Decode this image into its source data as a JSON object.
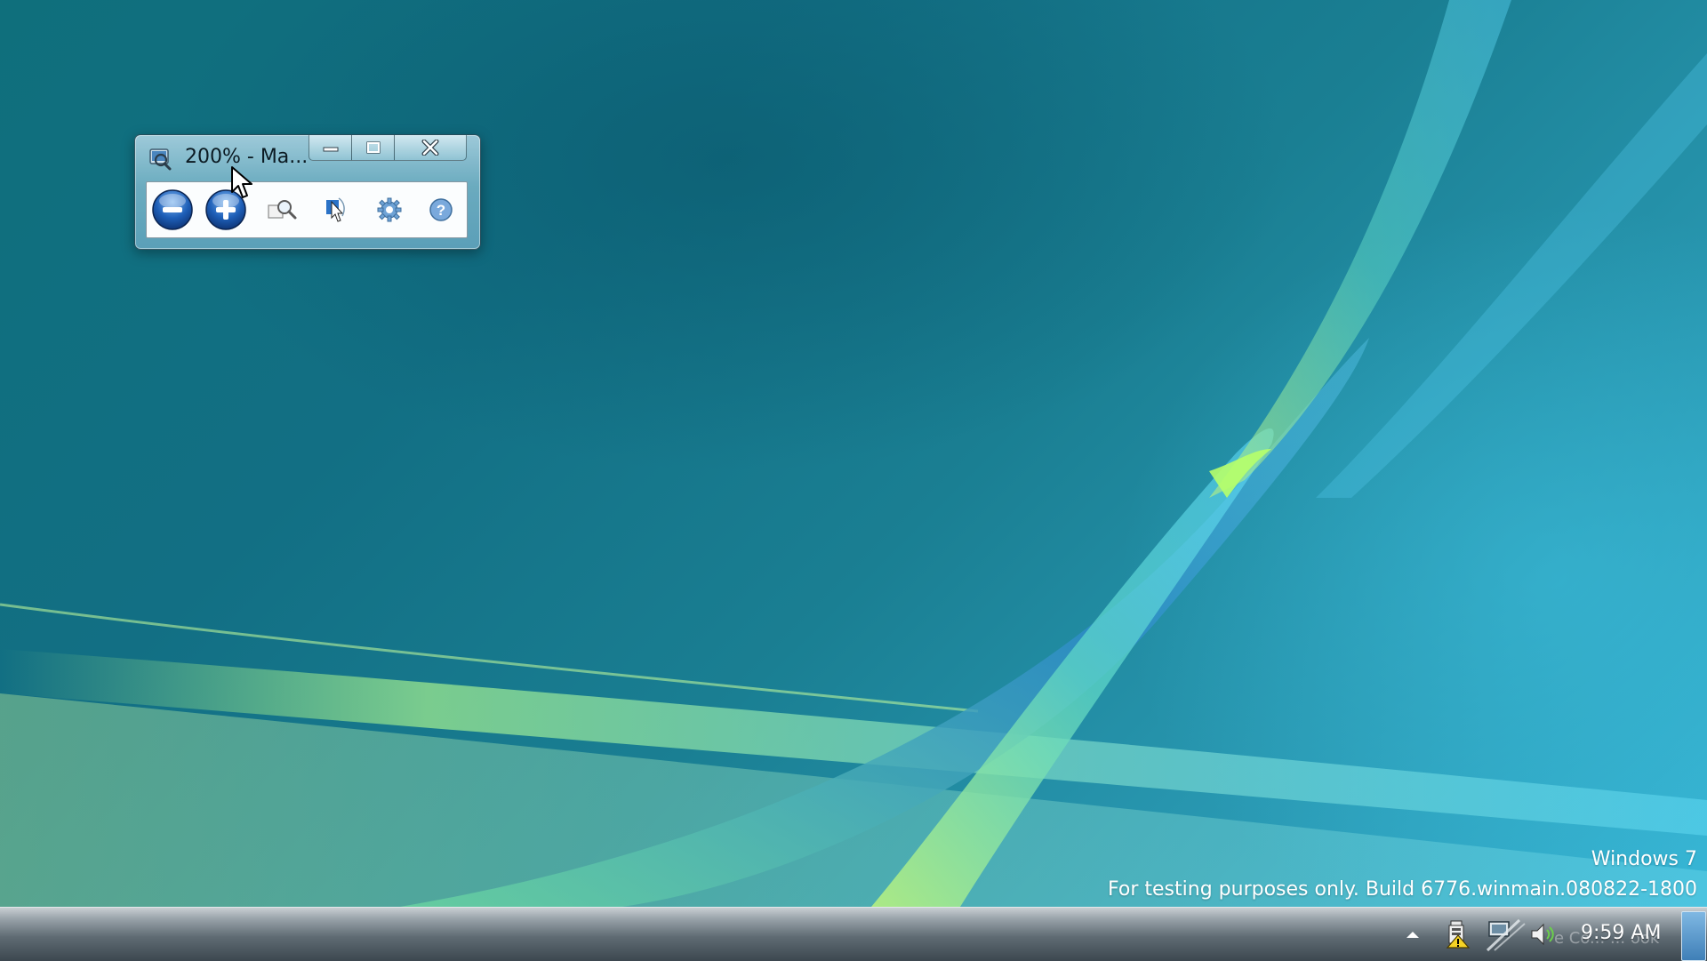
{
  "magnifier": {
    "title": "200% - Ma...",
    "caption_buttons": [
      "minimize",
      "maximize",
      "close"
    ],
    "toolbar": [
      {
        "name": "zoom-out-icon"
      },
      {
        "name": "zoom-in-icon"
      },
      {
        "name": "views-magnifier-icon"
      },
      {
        "name": "focus-tracking-icon"
      },
      {
        "name": "options-gear-icon"
      },
      {
        "name": "help-icon"
      }
    ]
  },
  "watermark": {
    "line1": "Windows 7",
    "line2": "For testing purposes only. Build 6776.winmain.080822-1800"
  },
  "taskbar": {
    "clock": "9:59 AM",
    "tray_ghost_text": "e Co... ... ook",
    "tray_icons": [
      "action-center-warning-icon",
      "network-icon",
      "volume-icon"
    ]
  },
  "colors": {
    "wallpaper_base": "#126f84",
    "wallpaper_light": "#37b6d6",
    "ribbon_green": "#7be27a",
    "taskbar_top": "#c9cfd3",
    "taskbar_bottom": "#3c474f",
    "zoom_button_blue": "#1e5fb8"
  }
}
